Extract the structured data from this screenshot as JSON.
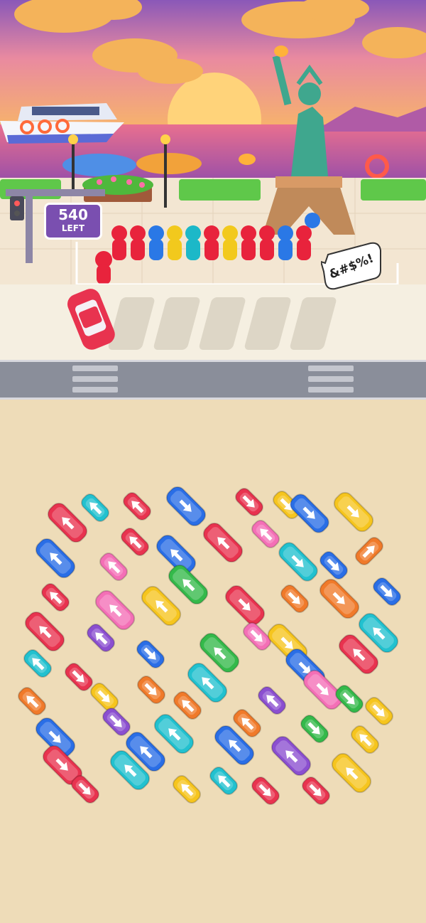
{
  "game": {
    "left_counter": {
      "value": "540",
      "label": "LEFT"
    },
    "speech_bubble": "&#$%!",
    "queue_people_colors": [
      "#e8233c",
      "#e8233c",
      "#2a78e6",
      "#f2c91d",
      "#1cb8c8",
      "#e8233c",
      "#f2c91d",
      "#e8233c",
      "#e8233c",
      "#2a78e6",
      "#e8233c"
    ],
    "colors": {
      "red": "#e8334f",
      "blue": "#2a6ee6",
      "cyan": "#22c1cf",
      "yellow": "#f6c51e",
      "pink": "#f46fb6",
      "green": "#34b94a",
      "orange": "#f07a2a",
      "purple": "#8b4fd0",
      "background": "#eedcb8",
      "road": "#8a8e9a"
    },
    "icons": [
      "boat-icon",
      "statue-of-liberty-icon",
      "traffic-light-icon",
      "lamp-post-icon",
      "arrow-icon"
    ]
  }
}
